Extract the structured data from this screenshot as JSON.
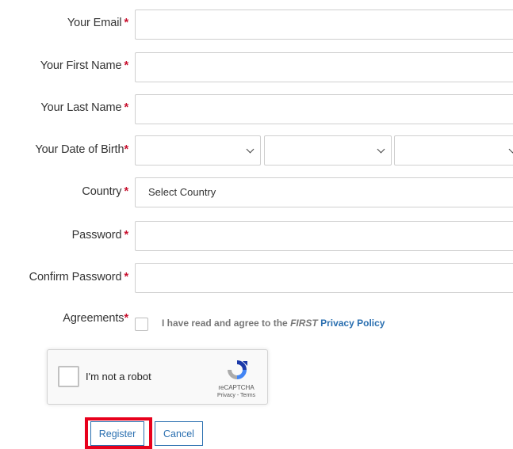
{
  "form": {
    "required_mark": "*",
    "email": {
      "label": "Your Email"
    },
    "first_name": {
      "label": "Your First Name"
    },
    "last_name": {
      "label": "Your Last Name"
    },
    "dob": {
      "label": "Your Date of Birth"
    },
    "country": {
      "label": "Country",
      "selected": "Select Country"
    },
    "password": {
      "label": "Password"
    },
    "confirm_password": {
      "label": "Confirm Password"
    },
    "agreements": {
      "label": "Agreements",
      "text_prefix": "I have read and agree to the",
      "text_first": "FIRST",
      "link_text": "Privacy Policy"
    }
  },
  "captcha": {
    "label": "I'm not a robot",
    "brand": "reCAPTCHA",
    "links": "Privacy - Terms"
  },
  "buttons": {
    "register": "Register",
    "cancel": "Cancel"
  },
  "colors": {
    "required": "#c8102e",
    "link": "#2a6fb0",
    "highlight": "#e8001c"
  }
}
